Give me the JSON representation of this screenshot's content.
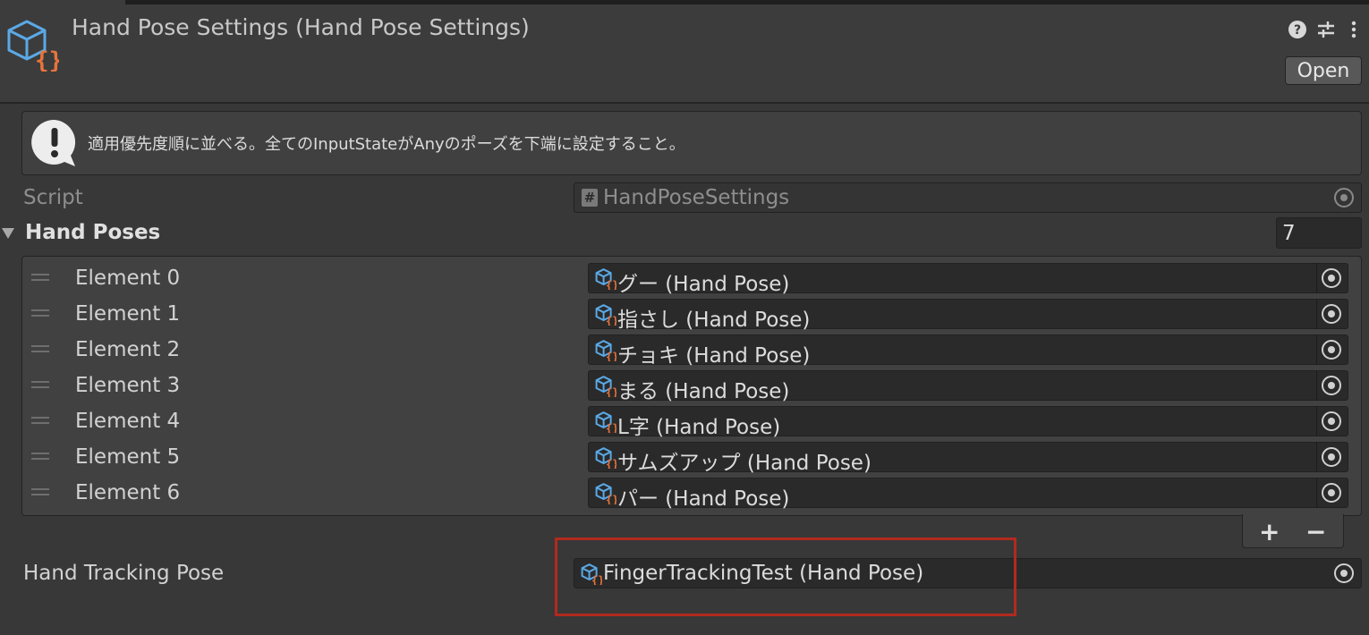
{
  "header": {
    "title": "Hand Pose Settings (Hand Pose Settings)",
    "open_label": "Open"
  },
  "help_box": {
    "message": "適用優先度順に並べる。全てのInputStateがAnyのポーズを下端に設定すること。"
  },
  "script_field": {
    "label": "Script",
    "value": "HandPoseSettings"
  },
  "hand_poses": {
    "label": "Hand Poses",
    "count": "7",
    "elements": [
      {
        "label": "Element 0",
        "value": "グー (Hand Pose)"
      },
      {
        "label": "Element 1",
        "value": "指さし (Hand Pose)"
      },
      {
        "label": "Element 2",
        "value": "チョキ (Hand Pose)"
      },
      {
        "label": "Element 3",
        "value": "まる (Hand Pose)"
      },
      {
        "label": "Element 4",
        "value": "L字 (Hand Pose)"
      },
      {
        "label": "Element 5",
        "value": "サムズアップ (Hand Pose)"
      },
      {
        "label": "Element 6",
        "value": "パー (Hand Pose)"
      }
    ],
    "add_label": "+",
    "remove_label": "−"
  },
  "hand_tracking": {
    "label": "Hand Tracking Pose",
    "value": "FingerTrackingTest (Hand Pose)"
  },
  "colors": {
    "background": "#383838",
    "field": "#2a2a2a",
    "icon_blue": "#5aa9e6",
    "icon_orange": "#e8743b",
    "highlight": "#b22a1e"
  }
}
